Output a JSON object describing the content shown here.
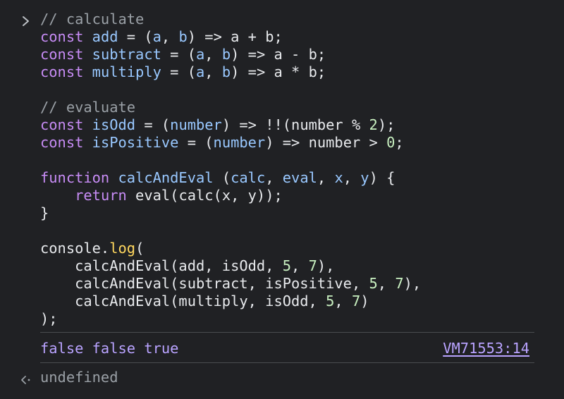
{
  "console": {
    "input_prompt_icon": "chevron-right-icon",
    "code_lines": [
      [
        {
          "t": "// calculate",
          "c": "comment"
        }
      ],
      [
        {
          "t": "const",
          "c": "keyword"
        },
        {
          "t": " ",
          "c": "plain"
        },
        {
          "t": "add",
          "c": "def"
        },
        {
          "t": " = (",
          "c": "plain"
        },
        {
          "t": "a",
          "c": "param"
        },
        {
          "t": ", ",
          "c": "plain"
        },
        {
          "t": "b",
          "c": "param"
        },
        {
          "t": ") => a + b;",
          "c": "plain"
        }
      ],
      [
        {
          "t": "const",
          "c": "keyword"
        },
        {
          "t": " ",
          "c": "plain"
        },
        {
          "t": "subtract",
          "c": "def"
        },
        {
          "t": " = (",
          "c": "plain"
        },
        {
          "t": "a",
          "c": "param"
        },
        {
          "t": ", ",
          "c": "plain"
        },
        {
          "t": "b",
          "c": "param"
        },
        {
          "t": ") => a - b;",
          "c": "plain"
        }
      ],
      [
        {
          "t": "const",
          "c": "keyword"
        },
        {
          "t": " ",
          "c": "plain"
        },
        {
          "t": "multiply",
          "c": "def"
        },
        {
          "t": " = (",
          "c": "plain"
        },
        {
          "t": "a",
          "c": "param"
        },
        {
          "t": ", ",
          "c": "plain"
        },
        {
          "t": "b",
          "c": "param"
        },
        {
          "t": ") => a * b;",
          "c": "plain"
        }
      ],
      [],
      [
        {
          "t": "// evaluate",
          "c": "comment"
        }
      ],
      [
        {
          "t": "const",
          "c": "keyword"
        },
        {
          "t": " ",
          "c": "plain"
        },
        {
          "t": "isOdd",
          "c": "def"
        },
        {
          "t": " = (",
          "c": "plain"
        },
        {
          "t": "number",
          "c": "param"
        },
        {
          "t": ") => !!(number % ",
          "c": "plain"
        },
        {
          "t": "2",
          "c": "number"
        },
        {
          "t": ");",
          "c": "plain"
        }
      ],
      [
        {
          "t": "const",
          "c": "keyword"
        },
        {
          "t": " ",
          "c": "plain"
        },
        {
          "t": "isPositive",
          "c": "def"
        },
        {
          "t": " = (",
          "c": "plain"
        },
        {
          "t": "number",
          "c": "param"
        },
        {
          "t": ") => number > ",
          "c": "plain"
        },
        {
          "t": "0",
          "c": "number"
        },
        {
          "t": ";",
          "c": "plain"
        }
      ],
      [],
      [
        {
          "t": "function",
          "c": "keyword"
        },
        {
          "t": " ",
          "c": "plain"
        },
        {
          "t": "calcAndEval",
          "c": "def"
        },
        {
          "t": " (",
          "c": "plain"
        },
        {
          "t": "calc",
          "c": "param"
        },
        {
          "t": ", ",
          "c": "plain"
        },
        {
          "t": "eval",
          "c": "param"
        },
        {
          "t": ", ",
          "c": "plain"
        },
        {
          "t": "x",
          "c": "param"
        },
        {
          "t": ", ",
          "c": "plain"
        },
        {
          "t": "y",
          "c": "param"
        },
        {
          "t": ") {",
          "c": "plain"
        }
      ],
      [
        {
          "t": "    ",
          "c": "plain"
        },
        {
          "t": "return",
          "c": "keyword"
        },
        {
          "t": " eval(calc(x, y));",
          "c": "plain"
        }
      ],
      [
        {
          "t": "}",
          "c": "plain"
        }
      ],
      [],
      [
        {
          "t": "console.",
          "c": "plain"
        },
        {
          "t": "log",
          "c": "prop"
        },
        {
          "t": "(",
          "c": "plain"
        }
      ],
      [
        {
          "t": "    calcAndEval(add, isOdd, ",
          "c": "plain"
        },
        {
          "t": "5",
          "c": "number"
        },
        {
          "t": ", ",
          "c": "plain"
        },
        {
          "t": "7",
          "c": "number"
        },
        {
          "t": "),",
          "c": "plain"
        }
      ],
      [
        {
          "t": "    calcAndEval(subtract, isPositive, ",
          "c": "plain"
        },
        {
          "t": "5",
          "c": "number"
        },
        {
          "t": ", ",
          "c": "plain"
        },
        {
          "t": "7",
          "c": "number"
        },
        {
          "t": "),",
          "c": "plain"
        }
      ],
      [
        {
          "t": "    calcAndEval(multiply, isOdd, ",
          "c": "plain"
        },
        {
          "t": "5",
          "c": "number"
        },
        {
          "t": ", ",
          "c": "plain"
        },
        {
          "t": "7",
          "c": "number"
        },
        {
          "t": ")",
          "c": "plain"
        }
      ],
      [
        {
          "t": ");",
          "c": "plain"
        }
      ]
    ],
    "output": {
      "values": "false false true",
      "source_link": "VM71553:14"
    },
    "result": {
      "icon": "return-arrow-icon",
      "value": "undefined"
    },
    "colors": {
      "background": "#202124",
      "keyword": "#c78cf5",
      "definition": "#99c8ff",
      "comment": "#9aa0a6",
      "number": "#c8f0c0",
      "property": "#ffd75e",
      "output": "#b9a3ff"
    }
  }
}
